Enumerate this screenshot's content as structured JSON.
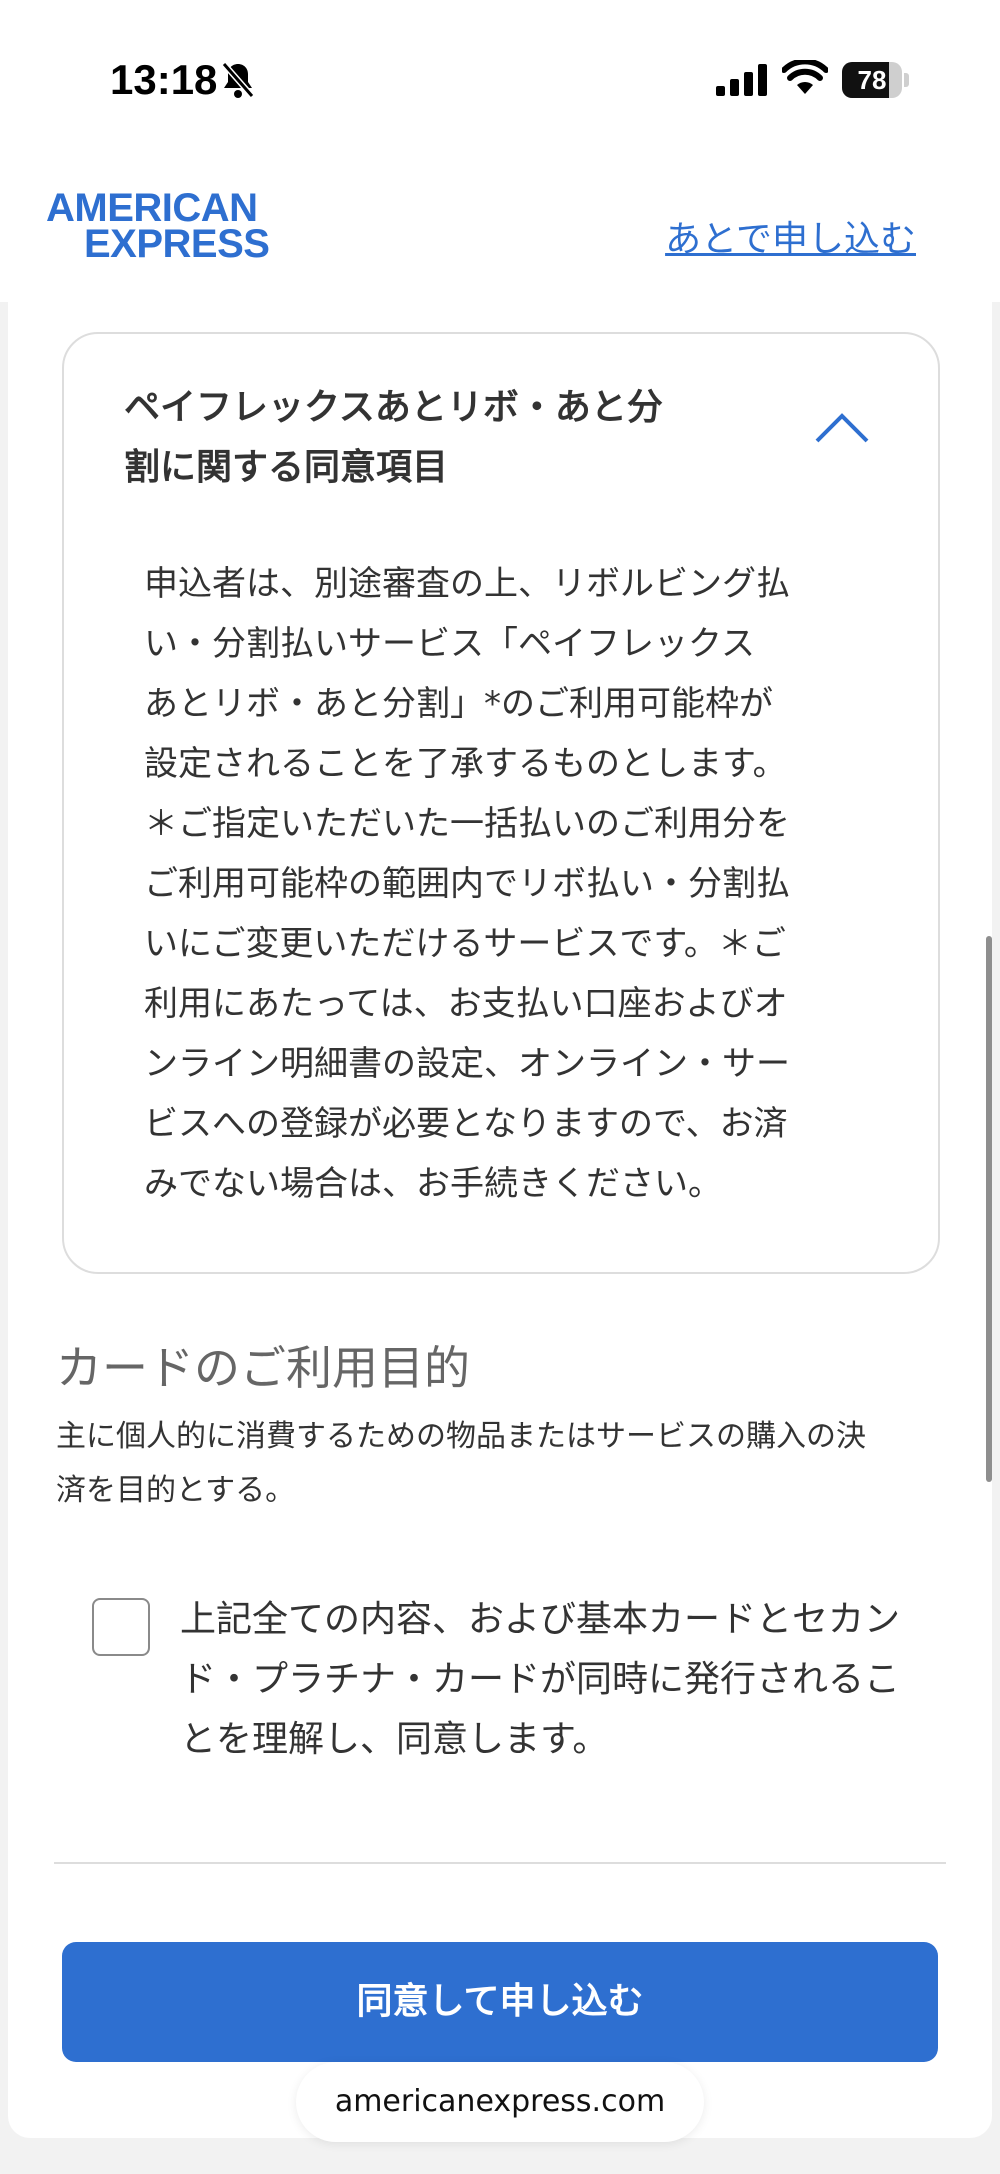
{
  "status_bar": {
    "time": "13:18",
    "battery": "78",
    "battery_level": 0.78,
    "icons": [
      "bell-slash-icon",
      "signal-icon",
      "wifi-icon",
      "battery-icon"
    ]
  },
  "header": {
    "logo_line1": "AMERICAN",
    "logo_line2": "EXPRESS",
    "later_link": "あとで申し込む",
    "accent_color": "#2e6fd0"
  },
  "consent": {
    "title_line1": "ペイフレックスあとリボ・あと分",
    "title_line2": "割に関する同意項目",
    "expanded_icon": "chevron-up-icon",
    "lines": [
      "申込者は、別途審査の上、リボルビング払",
      "い・分割払いサービス「ペイフレックス",
      "あとリボ・あと分割」*のご利用可能枠が",
      "設定されることを了承するものとします。",
      "＊ご指定いただいた一括払いのご利用分を",
      "ご利用可能枠の範囲内でリボ払い・分割払",
      "いにご変更いただけるサービスです。＊ご",
      "利用にあたっては、お支払い口座およびオ",
      "ンライン明細書の設定、オンライン・サー",
      "ビスへの登録が必要となりますので、お済",
      "みでない場合は、お手続きください。"
    ]
  },
  "purpose": {
    "title": "カードのご利用目的",
    "line1": "主に個人的に消費するための物品またはサービスの購入の決",
    "line2": "済を目的とする。"
  },
  "agreement": {
    "line1": "上記全ての内容、および基本カードとセカン",
    "line2": "ド・プラチナ・カードが同時に発行されるこ",
    "line3": "とを理解し、同意します。",
    "checked": false
  },
  "submit_label": "同意して申し込む",
  "browser_url": "americanexpress.com"
}
